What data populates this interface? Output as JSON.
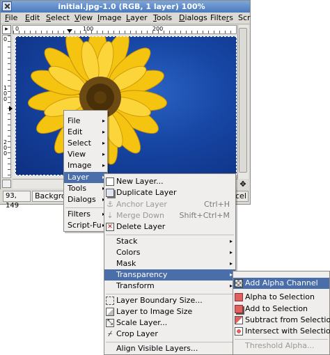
{
  "window": {
    "title": "initial.jpg-1.0 (RGB, 1 layer) 100%",
    "menubar": [
      "File",
      "Edit",
      "Select",
      "View",
      "Image",
      "Layer",
      "Tools",
      "Dialogs",
      "Filters",
      "Scr"
    ],
    "ruler_h_labels": [
      "0",
      "100",
      "200"
    ],
    "ruler_v_labels": [
      "0",
      "100",
      "200"
    ],
    "status": {
      "coords": "93, 149",
      "message": "Backgrou",
      "cancel_partial": "cel"
    }
  },
  "image_menu": {
    "items": [
      {
        "label": "File",
        "submenu": true
      },
      {
        "label": "Edit",
        "submenu": true
      },
      {
        "label": "Select",
        "submenu": true
      },
      {
        "label": "View",
        "submenu": true
      },
      {
        "label": "Image",
        "submenu": true
      },
      {
        "label": "Layer",
        "submenu": true,
        "highlighted": true
      },
      {
        "label": "Tools",
        "submenu": true
      },
      {
        "label": "Dialogs",
        "submenu": true
      },
      {
        "label": "Filters",
        "submenu": true
      },
      {
        "label": "Script-Fu",
        "submenu": true
      }
    ]
  },
  "layer_menu": {
    "items": [
      {
        "label": "New Layer...",
        "icon": "new-layer-icon"
      },
      {
        "label": "Duplicate Layer",
        "icon": "duplicate-layer-icon"
      },
      {
        "label": "Anchor Layer",
        "shortcut": "Ctrl+H",
        "disabled": true,
        "icon": "anchor-icon"
      },
      {
        "label": "Merge Down",
        "shortcut": "Shift+Ctrl+M",
        "disabled": true,
        "icon": "merge-down-icon"
      },
      {
        "label": "Delete Layer",
        "icon": "delete-layer-icon"
      },
      {
        "label": "Stack",
        "submenu": true
      },
      {
        "label": "Colors",
        "submenu": true
      },
      {
        "label": "Mask",
        "submenu": true
      },
      {
        "label": "Transparency",
        "submenu": true,
        "highlighted": true
      },
      {
        "label": "Transform",
        "submenu": true
      },
      {
        "label": "Layer Boundary Size...",
        "icon": "boundary-size-icon"
      },
      {
        "label": "Layer to Image Size",
        "icon": "layer-to-image-icon"
      },
      {
        "label": "Scale Layer...",
        "icon": "scale-layer-icon"
      },
      {
        "label": "Crop Layer",
        "icon": "crop-layer-icon"
      },
      {
        "label": "Align Visible Layers..."
      }
    ]
  },
  "transparency_menu": {
    "items": [
      {
        "label": "Add Alpha Channel",
        "highlighted": true,
        "icon": "alpha-channel-icon"
      },
      {
        "label": "Alpha to Selection",
        "icon": "alpha-to-selection-icon"
      },
      {
        "label": "Add to Selection",
        "icon": "add-to-selection-icon"
      },
      {
        "label": "Subtract from Selection",
        "icon": "subtract-from-selection-icon"
      },
      {
        "label": "Intersect with Selection",
        "icon": "intersect-selection-icon"
      },
      {
        "label": "Threshold Alpha...",
        "disabled": true
      }
    ]
  },
  "colors": {
    "highlight": "#4a6ea9",
    "sky": "#1645a3",
    "petals": "#f5c411",
    "center": "#6b4a14"
  }
}
